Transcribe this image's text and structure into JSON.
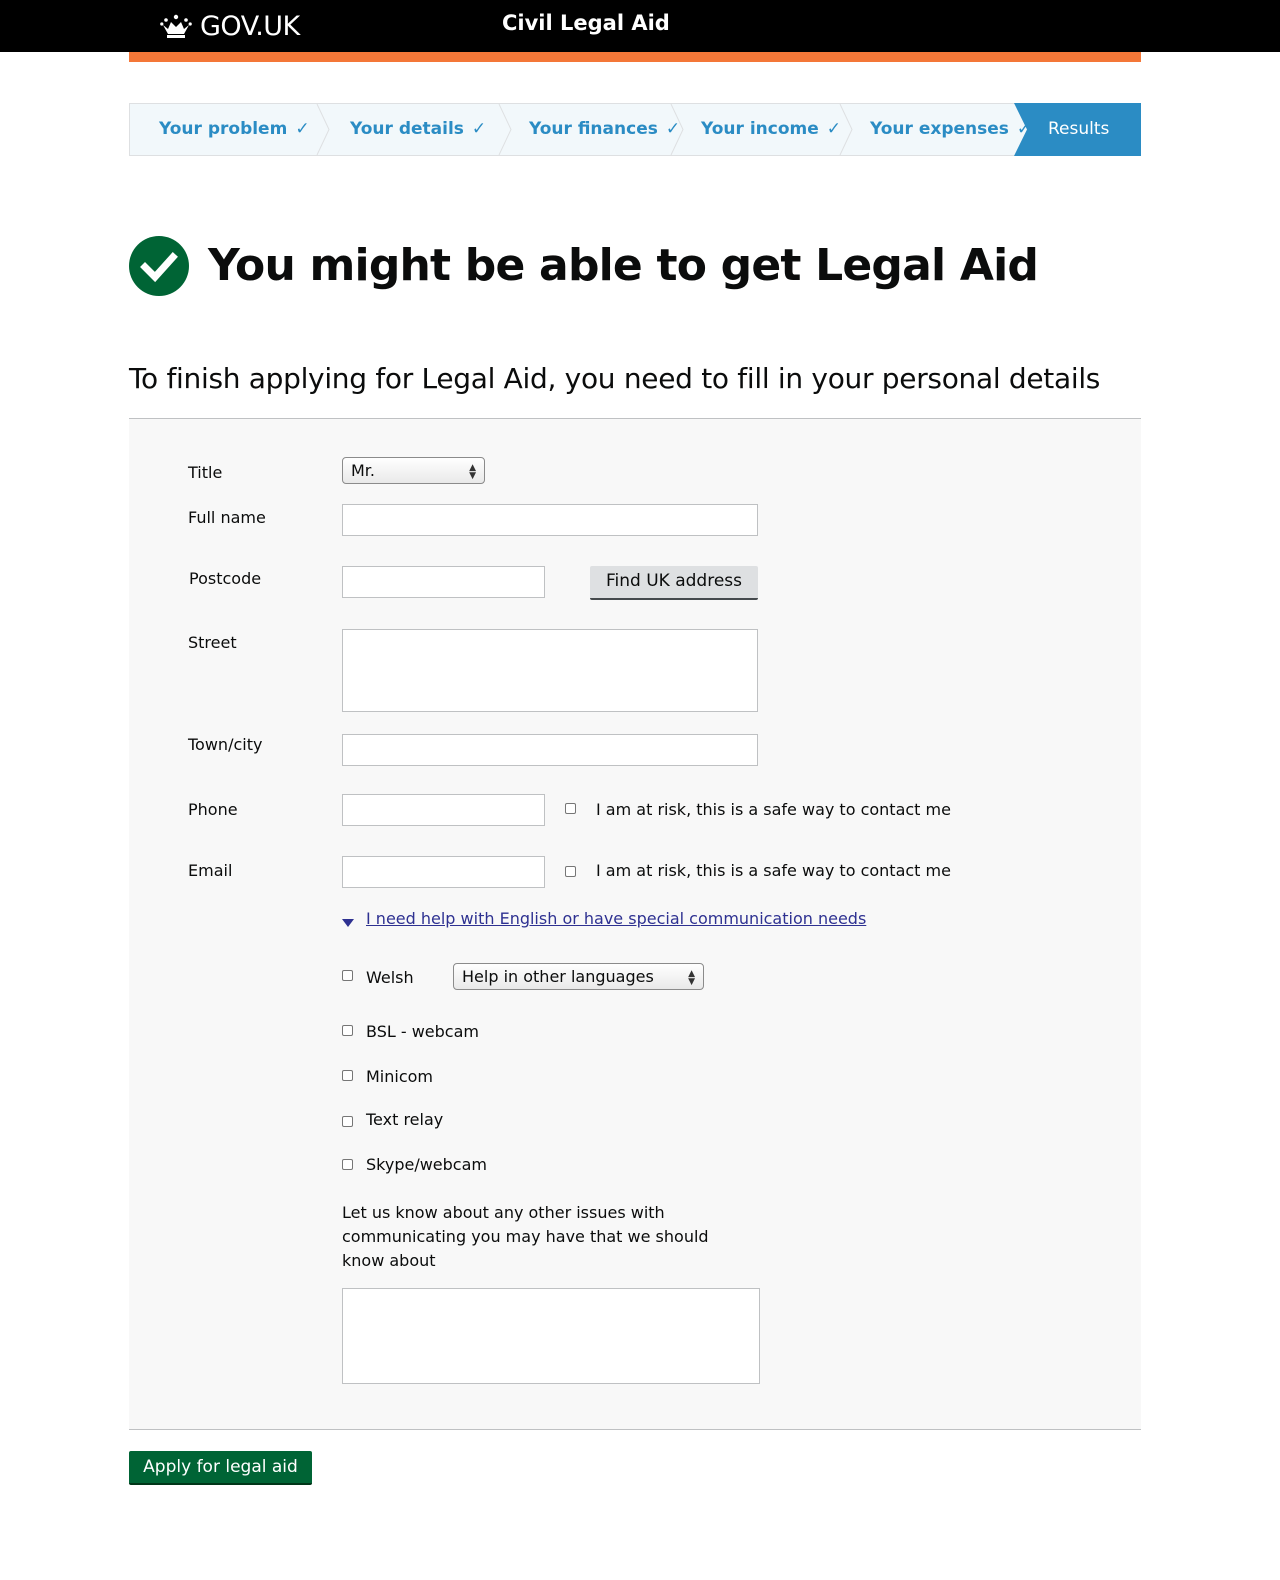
{
  "header": {
    "logo_text": "GOV.UK",
    "service_name": "Civil Legal Aid"
  },
  "colors": {
    "header_bg": "#000000",
    "accent_orange": "#f47738",
    "link_blue": "#2b8cc4",
    "success_green": "#006435"
  },
  "steps": {
    "items": [
      {
        "label": "Your problem",
        "state": "complete"
      },
      {
        "label": "Your details",
        "state": "complete"
      },
      {
        "label": "Your finances",
        "state": "complete"
      },
      {
        "label": "Your income",
        "state": "complete"
      },
      {
        "label": "Your expenses",
        "state": "complete"
      }
    ],
    "active": "Results",
    "tick": "✓"
  },
  "result": {
    "icon": "check-circle-icon",
    "headline": "You might be able to get Legal Aid",
    "subhead": "To finish applying for Legal Aid, you need to fill in your personal details"
  },
  "form": {
    "title_label": "Title",
    "title_value": "Mr.",
    "fullname_label": "Full name",
    "postcode_label": "Postcode",
    "find_address_button": "Find UK address",
    "street_label": "Street",
    "town_label": "Town/city",
    "phone_label": "Phone",
    "email_label": "Email",
    "safe_contact_label": "I am at risk, this is a safe way to contact me",
    "help_link": "I need help with English or have special communication needs",
    "welsh_label": "Welsh",
    "other_languages_value": "Help in other languages",
    "bsl_label": "BSL - webcam",
    "minicom_label": "Minicom",
    "text_relay_label": "Text relay",
    "skype_label": "Skype/webcam",
    "other_issues_text": "Let us know about any other issues with communicating you may have that we should know about"
  },
  "apply_button": "Apply for legal aid"
}
